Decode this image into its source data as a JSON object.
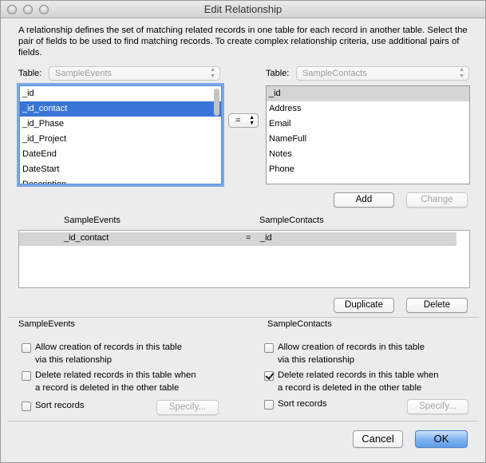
{
  "window": {
    "title": "Edit Relationship"
  },
  "description": "A relationship defines the set of matching related records in one table for each record in another table. Select the pair of fields to be used to find matching records. To create complex relationship criteria, use additional pairs of fields.",
  "left": {
    "table_label": "Table:",
    "table_value": "SampleEvents",
    "fields": [
      "_id",
      "_id_contact",
      "_id_Phase",
      "_id_Project",
      "DateEnd",
      "DateStart",
      "Description"
    ],
    "selected_index": 1
  },
  "operator": {
    "value": "="
  },
  "right": {
    "table_label": "Table:",
    "table_value": "SampleContacts",
    "fields": [
      "_id",
      "Address",
      "Email",
      "NameFull",
      "Notes",
      "Phone"
    ],
    "selected_index": 0
  },
  "buttons": {
    "add": "Add",
    "change": "Change",
    "duplicate": "Duplicate",
    "delete": "Delete",
    "specify": "Specify...",
    "cancel": "Cancel",
    "ok": "OK"
  },
  "relationship_table": {
    "col_left": "SampleEvents",
    "col_right": "SampleContacts",
    "rows": [
      {
        "left": "_id_contact",
        "op": "=",
        "right": "_id"
      }
    ]
  },
  "left_options": {
    "heading": "SampleEvents",
    "allow_creation": {
      "line1": "Allow creation of records in this table",
      "line2": "via this relationship",
      "checked": false
    },
    "delete_related": {
      "line1": "Delete related records in this table when",
      "line2": "a record is deleted in the other table",
      "checked": false
    },
    "sort_records": {
      "label": "Sort records",
      "checked": false
    }
  },
  "right_options": {
    "heading": "SampleContacts",
    "allow_creation": {
      "line1": "Allow creation of records in this table",
      "line2": "via this relationship",
      "checked": false
    },
    "delete_related": {
      "line1": "Delete related records in this table when",
      "line2": "a record is deleted in the other table",
      "checked": true
    },
    "sort_records": {
      "label": "Sort records",
      "checked": false
    }
  }
}
